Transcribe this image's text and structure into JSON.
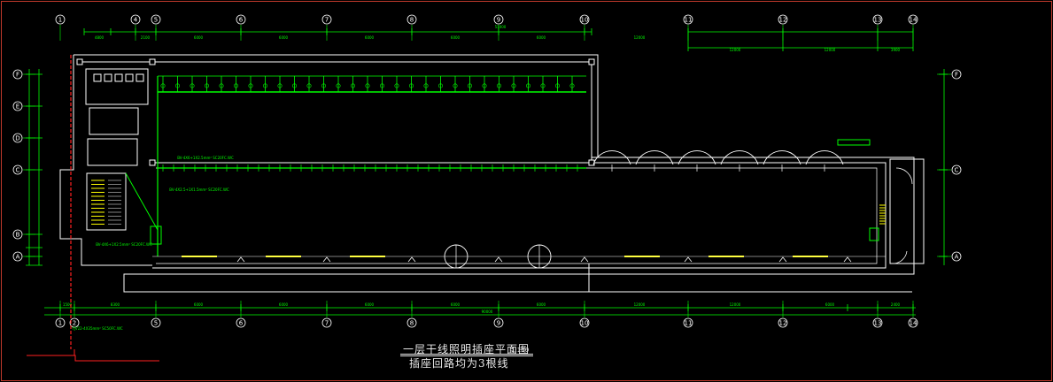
{
  "drawing": {
    "title": "一层干线照明插座平面图",
    "scale": "1:100",
    "subtitle": "插座回路均为3根线",
    "colors": {
      "wall": "#ffffff",
      "dimension": "#00ff00",
      "circuit": "#00ff00",
      "luminaire": "#ffff00",
      "feeder": "#ff2020",
      "frame": "#c0392b"
    }
  },
  "axes": {
    "top": [
      "1",
      "4",
      "5",
      "6",
      "7",
      "8",
      "9",
      "10",
      "11",
      "12",
      "13",
      "14"
    ],
    "bottom": [
      "1",
      "2",
      "5",
      "6",
      "7",
      "8",
      "9",
      "10",
      "11",
      "12",
      "13",
      "14"
    ],
    "left": [
      "F",
      "E",
      "D",
      "C",
      "B",
      "A"
    ],
    "right": [
      "F",
      "C",
      "A"
    ]
  },
  "annotations": {
    "feeder_top": "BV-4X6+1X2.5mm² SC20FC.WC",
    "feeder_mid": "BV-4X2.5+1X1.5mm² SC20FC.WC",
    "feeder_left": "BV-4X6+1X2.5mm² SC20FC.WC",
    "incoming": "YJV22-4X35mm² SC50FC.WC"
  }
}
